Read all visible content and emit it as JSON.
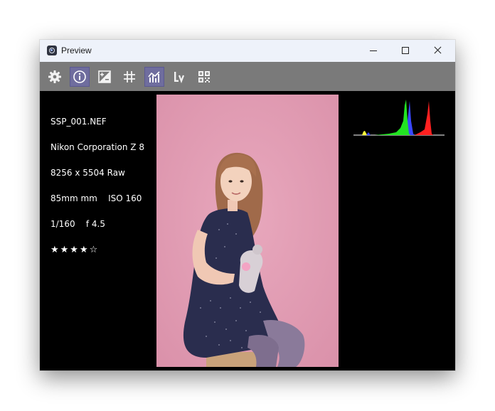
{
  "window": {
    "title": "Preview",
    "titlebar_color": "#eef2fa",
    "toolbar_color": "#7a7a7a",
    "active_tool_color": "#6f6d9e"
  },
  "toolbar": {
    "tools": [
      {
        "icon": "gear-icon",
        "active": false
      },
      {
        "icon": "info-icon",
        "active": true
      },
      {
        "icon": "exposure-icon",
        "active": false
      },
      {
        "icon": "grid-icon",
        "active": false
      },
      {
        "icon": "histogram-icon",
        "active": true
      },
      {
        "icon": "levels-icon",
        "active": false
      },
      {
        "icon": "qr-code-icon",
        "active": false
      }
    ]
  },
  "image_info": {
    "filename": "SSP_001.NEF",
    "camera": "Nikon Corporation Z 8",
    "dimensions": "8256 x 5504 Raw",
    "lens_iso": "85mm mm    ISO 160",
    "exposure": "1/160    f 4.5",
    "rating": "★★★★☆",
    "rating_value": 4,
    "rating_max": 5
  },
  "photo": {
    "background_color": "#e49fb6"
  },
  "histogram": {
    "channels": [
      "red",
      "green",
      "blue",
      "yellow"
    ],
    "colors": {
      "red": "#ff2020",
      "green": "#22e322",
      "blue": "#3a47ff",
      "yellow": "#ffff3a"
    }
  }
}
